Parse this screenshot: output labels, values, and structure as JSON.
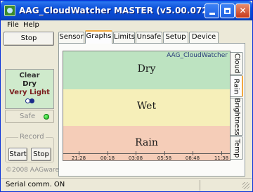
{
  "window": {
    "title": "AAG_CloudWatcher MASTER (v5.00.072)"
  },
  "titlebar_buttons": {
    "minimize": "minimize",
    "maximize": "maximize",
    "close": "✕"
  },
  "menu": {
    "file": "File",
    "help": "Help"
  },
  "left": {
    "stop_button": "Stop",
    "status": {
      "cloud": "Clear",
      "rain": "Dry",
      "light": "Very Light"
    },
    "safe": {
      "label": "Safe",
      "led_color": "#16b016"
    },
    "record": {
      "title": "Record",
      "start": "Start",
      "stop": "Stop"
    },
    "copyright": "©2008 AAGware"
  },
  "tabs": [
    "Sensor",
    "Graphs",
    "Limits",
    "Unsafe",
    "Setup",
    "Device"
  ],
  "active_tab": "Graphs",
  "graph": {
    "watermark": "AAG_CloudWatcher",
    "bands": [
      {
        "label": "Dry",
        "color": "#bde3c1"
      },
      {
        "label": "Wet",
        "color": "#f6efb9"
      },
      {
        "label": "Rain",
        "color": "#f5cdb8"
      }
    ],
    "x_ticks": [
      "21:28",
      "00:18",
      "03:08",
      "05:58",
      "08:48",
      "11:38"
    ]
  },
  "side_tabs": [
    "Cloud",
    "Rain",
    "Brightness",
    "Temp"
  ],
  "active_side_tab": "Rain",
  "statusbar": {
    "text": "Serial comm. ON"
  }
}
